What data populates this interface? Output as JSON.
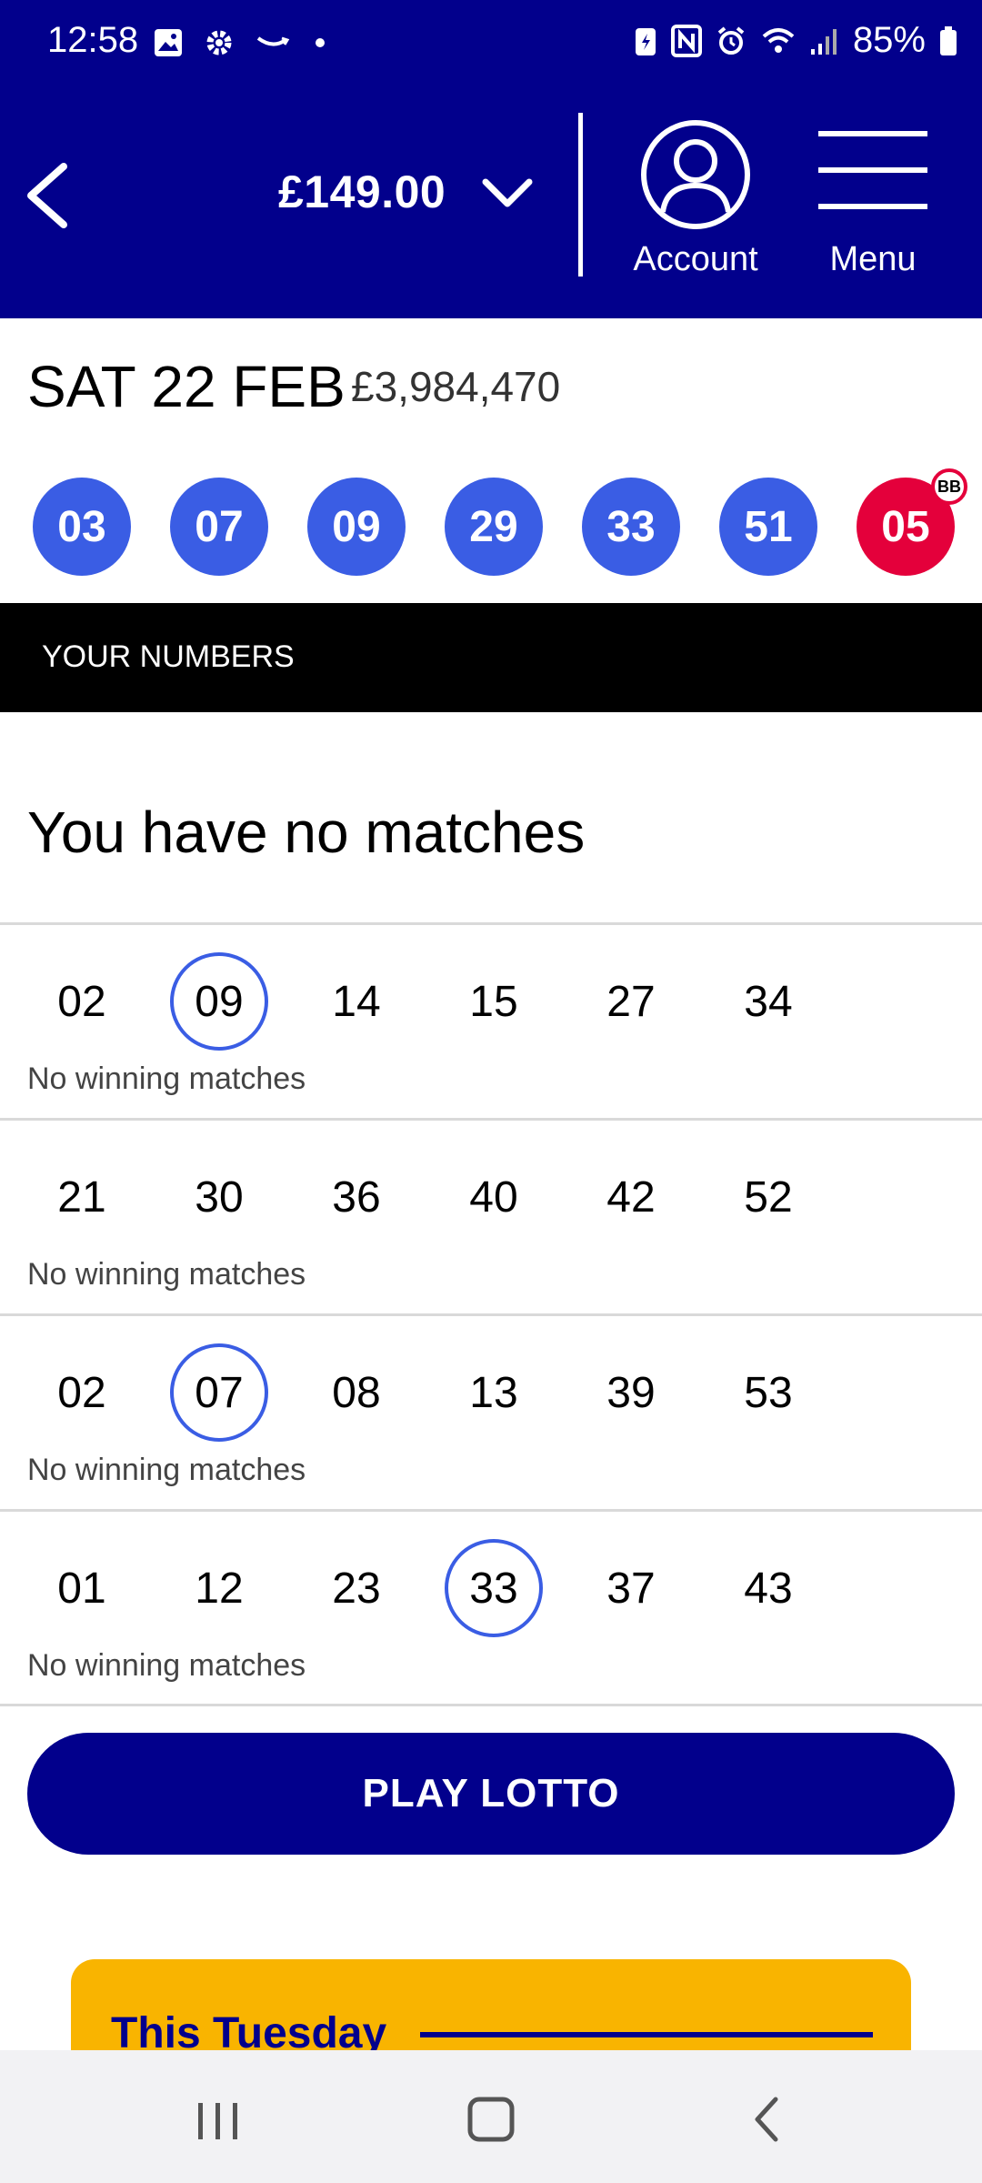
{
  "status_bar": {
    "time": "12:58",
    "battery": "85%",
    "icons_left": [
      "image-icon",
      "gear-icon",
      "amazon-icon",
      "dot-icon"
    ],
    "icons_right": [
      "battery-saver-icon",
      "nfc-icon",
      "alarm-icon",
      "wifi-icon",
      "signal-icon",
      "battery-icon"
    ]
  },
  "header": {
    "balance": "£149.00",
    "account_label": "Account",
    "menu_label": "Menu"
  },
  "draw": {
    "date": "SAT 22 FEB",
    "jackpot": "£3,984,470",
    "balls": [
      "03",
      "07",
      "09",
      "29",
      "33",
      "51"
    ],
    "bonus_ball": "05",
    "bonus_badge": "BB"
  },
  "section_title": "YOUR NUMBERS",
  "result_heading": "You have no matches",
  "tickets": [
    {
      "numbers": [
        "02",
        "09",
        "14",
        "15",
        "27",
        "34"
      ],
      "matched": [
        "09"
      ],
      "status": "No winning matches"
    },
    {
      "numbers": [
        "21",
        "30",
        "36",
        "40",
        "42",
        "52"
      ],
      "matched": [],
      "status": "No winning matches"
    },
    {
      "numbers": [
        "02",
        "07",
        "08",
        "13",
        "39",
        "53"
      ],
      "matched": [
        "07"
      ],
      "status": "No winning matches"
    },
    {
      "numbers": [
        "01",
        "12",
        "23",
        "33",
        "37",
        "43"
      ],
      "matched": [
        "33"
      ],
      "status": "No winning matches"
    }
  ],
  "play_button": "PLAY LOTTO",
  "promo": {
    "title": "This Tuesday"
  },
  "nav": [
    "recents-icon",
    "home-icon",
    "back-icon"
  ],
  "colors": {
    "brand_navy": "#02008c",
    "ball_blue": "#3a5de4",
    "bonus_red": "#e4003b",
    "promo_yellow": "#f9b400"
  }
}
